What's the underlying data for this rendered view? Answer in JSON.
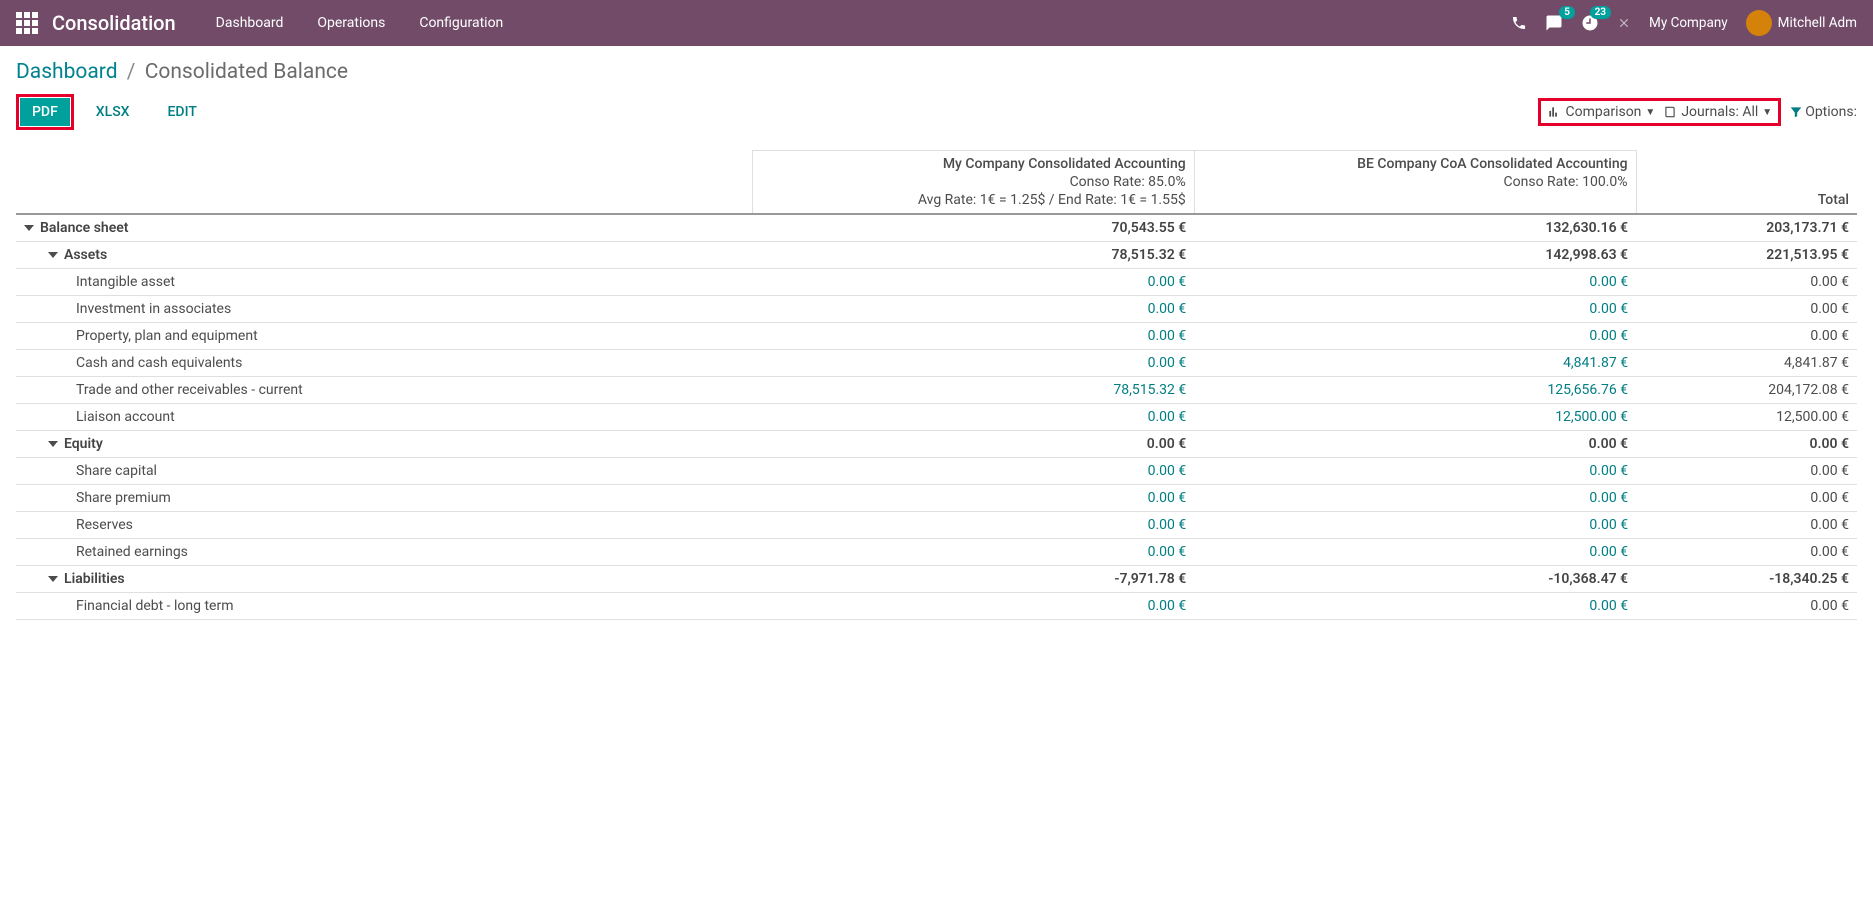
{
  "nav": {
    "brand": "Consolidation",
    "menu": [
      "Dashboard",
      "Operations",
      "Configuration"
    ],
    "company": "My Company",
    "user": "Mitchell Adm",
    "msg_badge": "5",
    "activity_badge": "23"
  },
  "breadcrumb": {
    "root": "Dashboard",
    "current": "Consolidated Balance"
  },
  "buttons": {
    "pdf": "PDF",
    "xlsx": "XLSX",
    "edit": "EDIT"
  },
  "filters": {
    "comparison": "Comparison",
    "journals": "Journals: All",
    "options": "Options:"
  },
  "columns": [
    {
      "title": "My Company Consolidated Accounting",
      "rate": "Conso Rate: 85.0%",
      "avg": "Avg Rate: 1€ = 1.25$ / End Rate: 1€ = 1.55$"
    },
    {
      "title": "BE Company CoA Consolidated Accounting",
      "rate": "Conso Rate: 100.0%",
      "avg": ""
    },
    {
      "title": "Total",
      "rate": "",
      "avg": ""
    }
  ],
  "rows": [
    {
      "level": 0,
      "caret": true,
      "name": "Balance sheet",
      "v": [
        "70,543.55 €",
        "132,630.16 €",
        "203,173.71 €"
      ],
      "link": false
    },
    {
      "level": 1,
      "caret": true,
      "name": "Assets",
      "v": [
        "78,515.32 €",
        "142,998.63 €",
        "221,513.95 €"
      ],
      "link": false
    },
    {
      "level": 2,
      "caret": false,
      "name": "Intangible asset",
      "v": [
        "0.00 €",
        "0.00 €",
        "0.00 €"
      ],
      "link": true
    },
    {
      "level": 2,
      "caret": false,
      "name": "Investment in associates",
      "v": [
        "0.00 €",
        "0.00 €",
        "0.00 €"
      ],
      "link": true
    },
    {
      "level": 2,
      "caret": false,
      "name": "Property, plan and equipment",
      "v": [
        "0.00 €",
        "0.00 €",
        "0.00 €"
      ],
      "link": true
    },
    {
      "level": 2,
      "caret": false,
      "name": "Cash and cash equivalents",
      "v": [
        "0.00 €",
        "4,841.87 €",
        "4,841.87 €"
      ],
      "link": true
    },
    {
      "level": 2,
      "caret": false,
      "name": "Trade and other receivables - current",
      "v": [
        "78,515.32 €",
        "125,656.76 €",
        "204,172.08 €"
      ],
      "link": true
    },
    {
      "level": 2,
      "caret": false,
      "name": "Liaison account",
      "v": [
        "0.00 €",
        "12,500.00 €",
        "12,500.00 €"
      ],
      "link": true
    },
    {
      "level": 1,
      "caret": true,
      "name": "Equity",
      "v": [
        "0.00 €",
        "0.00 €",
        "0.00 €"
      ],
      "link": false
    },
    {
      "level": 2,
      "caret": false,
      "name": "Share capital",
      "v": [
        "0.00 €",
        "0.00 €",
        "0.00 €"
      ],
      "link": true
    },
    {
      "level": 2,
      "caret": false,
      "name": "Share premium",
      "v": [
        "0.00 €",
        "0.00 €",
        "0.00 €"
      ],
      "link": true
    },
    {
      "level": 2,
      "caret": false,
      "name": "Reserves",
      "v": [
        "0.00 €",
        "0.00 €",
        "0.00 €"
      ],
      "link": true
    },
    {
      "level": 2,
      "caret": false,
      "name": "Retained earnings",
      "v": [
        "0.00 €",
        "0.00 €",
        "0.00 €"
      ],
      "link": true
    },
    {
      "level": 1,
      "caret": true,
      "name": "Liabilities",
      "v": [
        "-7,971.78 €",
        "-10,368.47 €",
        "-18,340.25 €"
      ],
      "link": false
    },
    {
      "level": 2,
      "caret": false,
      "name": "Financial debt - long term",
      "v": [
        "0.00 €",
        "0.00 €",
        "0.00 €"
      ],
      "link": true
    }
  ]
}
